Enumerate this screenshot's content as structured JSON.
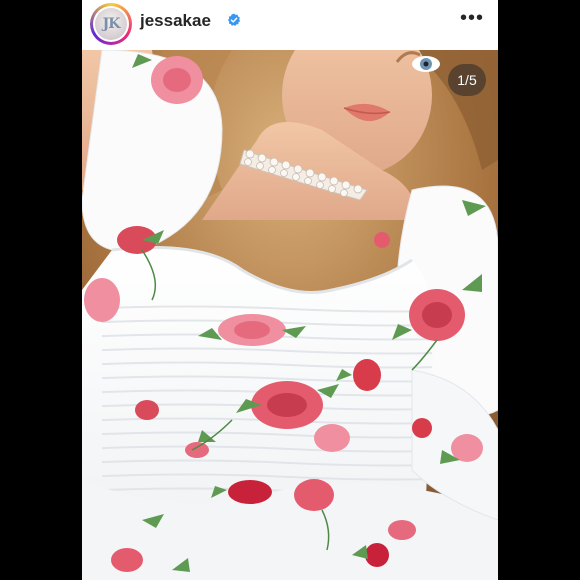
{
  "post": {
    "username": "jessakae",
    "avatar_initials": "JK",
    "verified": true,
    "more_icon": "more-horizontal-icon",
    "carousel_counter": "1/5"
  },
  "colors": {
    "background": "#000000",
    "verified_blue": "#3897f0",
    "text": "#262626"
  }
}
